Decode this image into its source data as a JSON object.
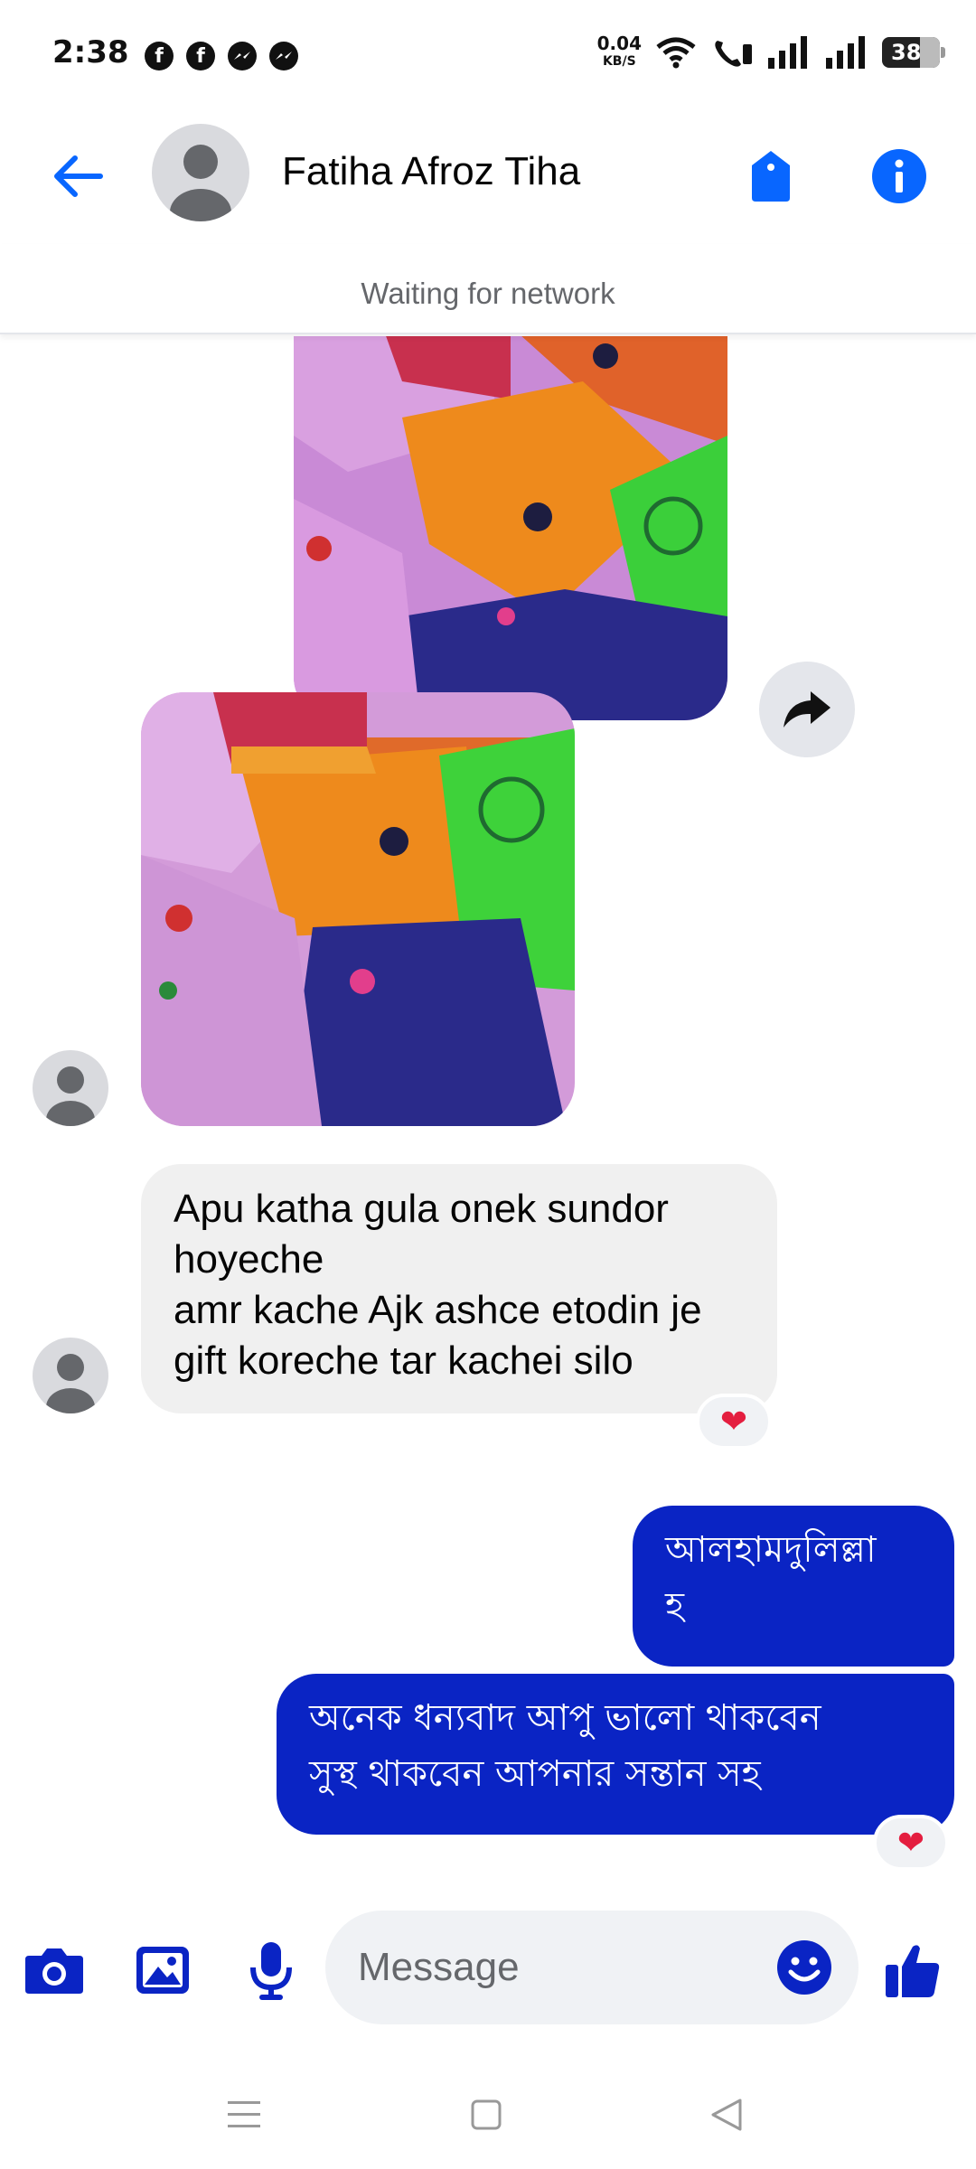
{
  "status_bar": {
    "time": "2:38",
    "app_icons": [
      "facebook-icon",
      "facebook-icon",
      "messenger-icon",
      "messenger-icon"
    ],
    "net_speed_value": "0.04",
    "net_speed_unit": "KB/S",
    "battery": "38"
  },
  "header": {
    "contact_name": "Fatiha Afroz Tiha",
    "network_status": "Waiting for network",
    "accent_color": "#0866ff"
  },
  "messages": {
    "incoming_text": "Apu katha gula onek sundor\nhoyeche\namr kache Ajk ashce etodin je\ngift koreche tar kachei silo",
    "incoming_reaction": "❤",
    "outgoing_1": "আলহামদুলিল্লা\nহ",
    "outgoing_2": "অনেক ধন্যবাদ আপু ভালো থাকবেন\nসুস্থ থাকবেন আপনার সন্তান সহ",
    "outgoing_reaction": "❤",
    "outgoing_color": "#0a24c4"
  },
  "composer": {
    "placeholder": "Message"
  }
}
